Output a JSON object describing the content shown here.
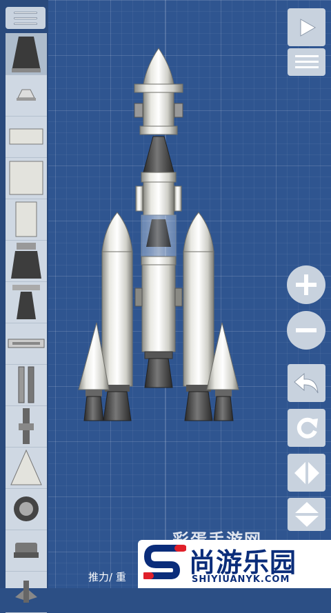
{
  "toolbar": {
    "menu_icon": "hamburger-icon",
    "play_icon": "play-icon",
    "list_icon": "list-icon"
  },
  "parts": [
    {
      "name": "nose-cone-dark-part"
    },
    {
      "name": "small-cap-part"
    },
    {
      "name": "short-fuel-tank-part"
    },
    {
      "name": "fuel-tank-part"
    },
    {
      "name": "narrow-tank-part"
    },
    {
      "name": "engine-large-part"
    },
    {
      "name": "engine-bell-part"
    },
    {
      "name": "separator-part"
    },
    {
      "name": "side-separator-part"
    },
    {
      "name": "parachute-part"
    },
    {
      "name": "cone-part"
    },
    {
      "name": "wheel-part"
    },
    {
      "name": "cap-part"
    },
    {
      "name": "fin-part"
    }
  ],
  "controls": {
    "zoom_in": "+",
    "zoom_out": "−"
  },
  "status": {
    "text": "推力/ 重"
  },
  "watermark": {
    "faded_text": "彩蛋手游网",
    "chinese": "尚游乐园",
    "english": "SHIYIUANYK.COM"
  },
  "colors": {
    "background": "#2f5590",
    "panel": "#cfd8e3",
    "brand": "#0b2d7a",
    "accent_red": "#e0202a"
  }
}
